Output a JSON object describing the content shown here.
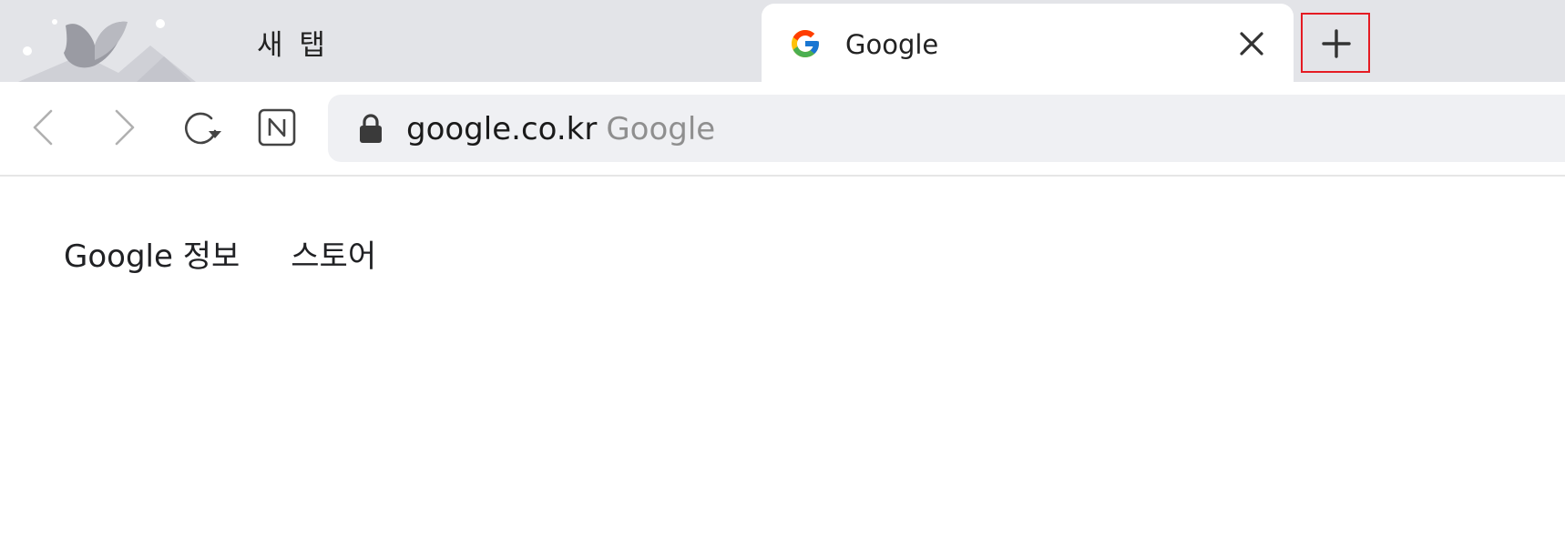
{
  "tabs": {
    "inactive": {
      "label": "새 탭"
    },
    "active": {
      "label": "Google",
      "favicon": "google-g-icon"
    },
    "close_icon": "close-icon",
    "new_tab_icon": "plus-icon"
  },
  "toolbar": {
    "back_icon": "chevron-left-icon",
    "forward_icon": "chevron-right-icon",
    "reload_icon": "reload-icon",
    "naver_icon": "naver-n-icon"
  },
  "omnibox": {
    "lock_icon": "lock-icon",
    "host": "google.co.kr",
    "page_title": "Google"
  },
  "page": {
    "links": {
      "about": "Google 정보",
      "store": "스토어"
    }
  },
  "colors": {
    "tabstrip_bg": "#e3e4e8",
    "omnibox_bg": "#eff0f3",
    "highlight_border": "#e51b23"
  }
}
